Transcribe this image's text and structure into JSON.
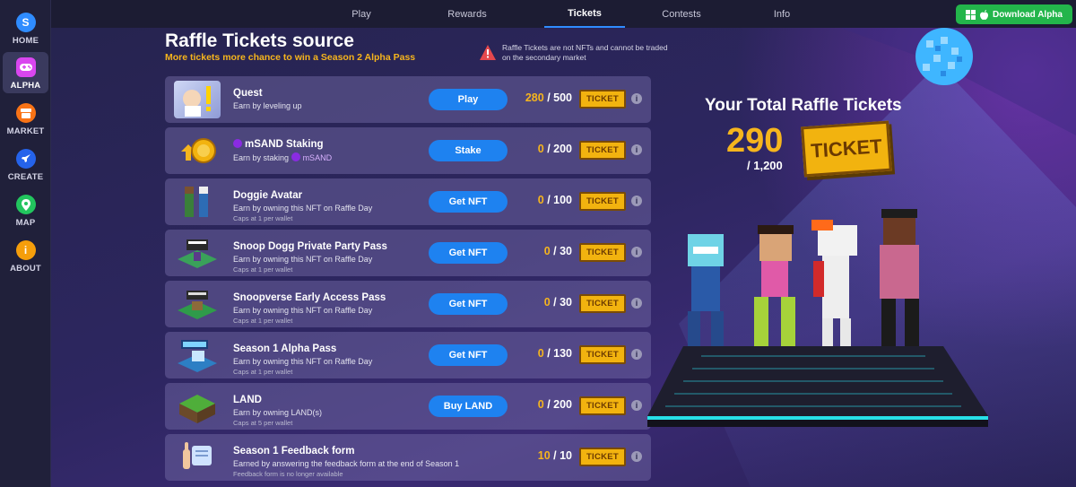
{
  "sidebar": {
    "items": [
      {
        "label": "HOME",
        "icon": "sandbox-logo-icon",
        "color": "#2f8cff",
        "glyph": "S"
      },
      {
        "label": "ALPHA",
        "icon": "gamepad-icon",
        "color": "#d946ef",
        "glyph": "▣"
      },
      {
        "label": "MARKET",
        "icon": "market-icon",
        "color": "#f97316",
        "glyph": "▤"
      },
      {
        "label": "CREATE",
        "icon": "rocket-icon",
        "color": "#2563eb",
        "glyph": "➶"
      },
      {
        "label": "MAP",
        "icon": "map-pin-icon",
        "color": "#22c55e",
        "glyph": "●"
      },
      {
        "label": "ABOUT",
        "icon": "info-icon",
        "color": "#f59e0b",
        "glyph": "i"
      }
    ],
    "active": "ALPHA"
  },
  "nav": {
    "tabs": [
      "Play",
      "Rewards",
      "Tickets",
      "Contests",
      "Info"
    ],
    "active": "Tickets",
    "download_label": "Download Alpha"
  },
  "page": {
    "title": "Raffle Tickets source",
    "subtitle": "More tickets more chance to win a Season 2 Alpha Pass",
    "warning": "Raffle Tickets are not NFTs and cannot be traded on the secondary market"
  },
  "rows": [
    {
      "title": "Quest",
      "sub": "Earn by leveling up",
      "cap": "",
      "button": "Play",
      "current": "280",
      "max": "/ 500",
      "ticket": "TICKET"
    },
    {
      "title": "mSAND Staking",
      "sub": "Earn by staking",
      "sub_token": "mSAND",
      "cap": "",
      "button": "Stake",
      "current": "0",
      "max": "/ 200",
      "ticket": "TICKET"
    },
    {
      "title": "Doggie Avatar",
      "sub": "Earn by owning this NFT on Raffle Day",
      "cap": "Caps at 1 per wallet",
      "button": "Get NFT",
      "current": "0",
      "max": "/ 100",
      "ticket": "TICKET"
    },
    {
      "title": "Snoop Dogg Private Party Pass",
      "sub": "Earn by owning this NFT on Raffle Day",
      "cap": "Caps at 1 per wallet",
      "button": "Get NFT",
      "current": "0",
      "max": "/ 30",
      "ticket": "TICKET"
    },
    {
      "title": "Snoopverse Early Access Pass",
      "sub": "Earn by owning this NFT on Raffle Day",
      "cap": "Caps at 1 per wallet",
      "button": "Get NFT",
      "current": "0",
      "max": "/ 30",
      "ticket": "TICKET"
    },
    {
      "title": "Season 1 Alpha Pass",
      "sub": "Earn by owning this NFT on Raffle Day",
      "cap": "Caps at 1 per wallet",
      "button": "Get NFT",
      "current": "0",
      "max": "/ 130",
      "ticket": "TICKET"
    },
    {
      "title": "LAND",
      "sub": "Earn by owning LAND(s)",
      "cap": "Caps at 5 per wallet",
      "button": "Buy LAND",
      "current": "0",
      "max": "/ 200",
      "ticket": "TICKET"
    },
    {
      "title": "Season 1 Feedback form",
      "sub": "Earned by answering the feedback form at the end of Season 1",
      "cap": "Feedback form is no longer available",
      "button": "",
      "current": "10",
      "max": "/ 10",
      "ticket": "TICKET"
    }
  ],
  "total": {
    "title": "Your Total Raffle Tickets",
    "value": "290",
    "max": "/ 1,200",
    "ticket": "TICKET"
  },
  "colors": {
    "accent": "#1e82f0",
    "gold": "#f6b51d",
    "download": "#23b54b"
  }
}
